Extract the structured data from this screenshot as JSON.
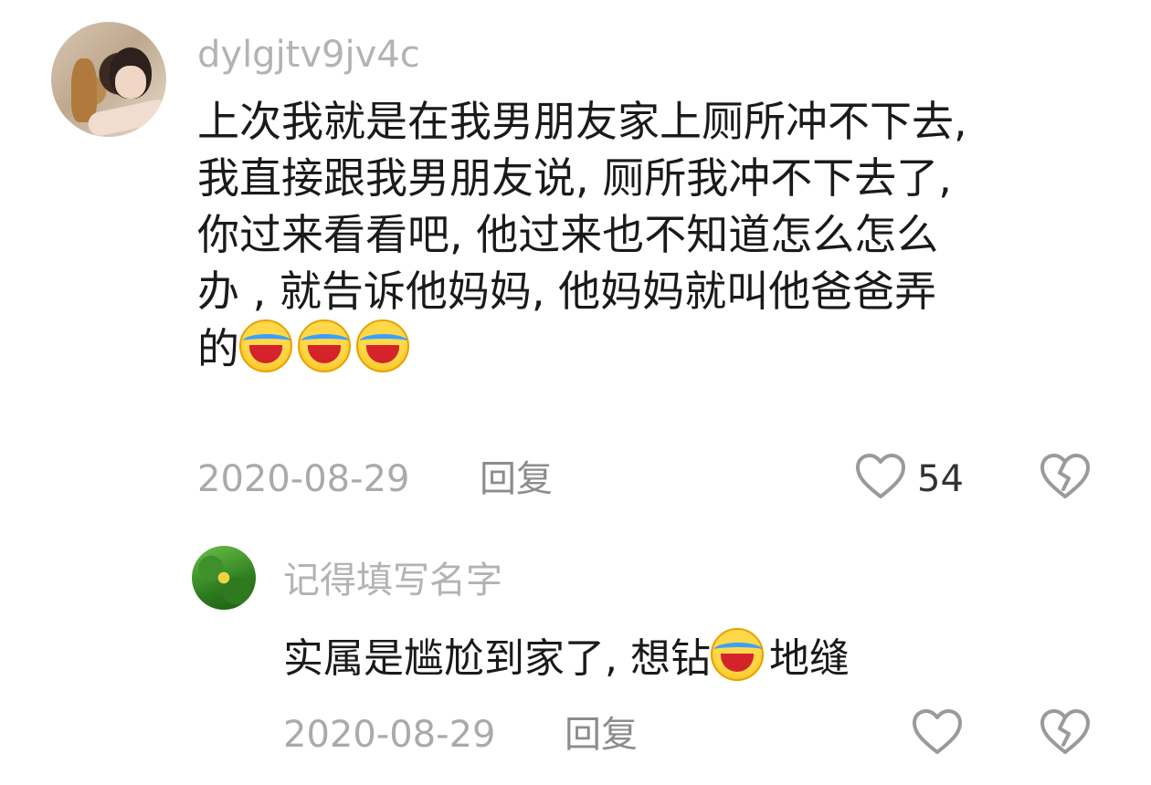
{
  "comment": {
    "username": "dylgjtv9jv4c",
    "lines": [
      "上次我就是在我男朋友家上厕所冲不下去,",
      "我直接跟我男朋友说, 厕所我冲不下去了,",
      "你过来看看吧, 他过来也不知道怎么怎么",
      "办 , 就告诉他妈妈, 他妈妈就叫他爸爸弄",
      "的"
    ],
    "emoji_count": 3,
    "date": "2020-08-29",
    "reply_label": "回复",
    "like_count": "54"
  },
  "reply": {
    "username": "记得填写名字",
    "text_before_emoji": "实属是尴尬到家了, 想钻",
    "text_after_emoji": "地缝",
    "date": "2020-08-29",
    "reply_label": "回复"
  },
  "icons": {
    "like": "heart-outline-icon",
    "dislike": "broken-heart-icon",
    "emoji": "facepalm-laugh-emoji"
  }
}
